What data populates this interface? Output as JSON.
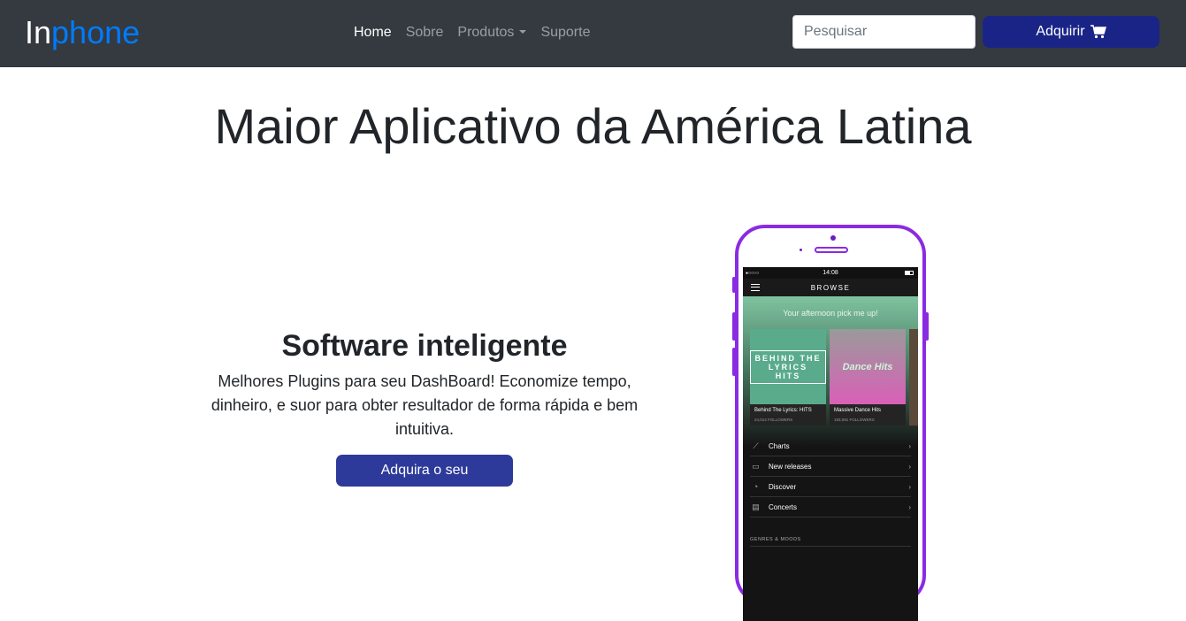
{
  "nav": {
    "brand_part1": "In",
    "brand_part2": "phone",
    "links": [
      "Home",
      "Sobre",
      "Produtos",
      "Suporte"
    ],
    "search_placeholder": "Pesquisar",
    "buy_label": "Adquirir"
  },
  "hero": {
    "title": "Maior Aplicativo da América Latina",
    "subtitle": "Software inteligente",
    "description": "Melhores Plugins para seu DashBoard! Economize tempo, dinheiro, e suor para obter resultador de forma rápida e bem intuitiva.",
    "cta": "Adquira o seu"
  },
  "phone": {
    "time": "14:08",
    "header": "BROWSE",
    "pick": "Your afternoon pick me up!",
    "cards": [
      {
        "art": "BEHIND THE LYRICS HITS",
        "title": "Behind The Lyrics: HITS",
        "followers": "24,014 FOLLOWERS"
      },
      {
        "art": "Dance Hits",
        "title": "Massive Dance Hits",
        "followers": "193,091 FOLLOWERS"
      }
    ],
    "list": [
      "Charts",
      "New releases",
      "Discover",
      "Concerts"
    ],
    "genres": "GENRES & MOODS"
  },
  "colors": {
    "navbar": "#343a40",
    "brand_blue": "#007bff",
    "buy": "#1a2487",
    "phone_frame": "#8a2be2"
  }
}
